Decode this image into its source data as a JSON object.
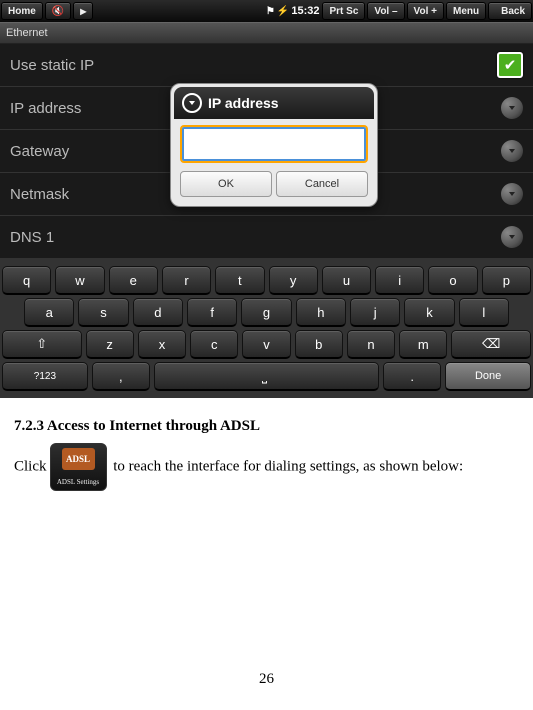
{
  "statusbar": {
    "home": "Home",
    "time": "15:32",
    "prtsc": "Prt Sc",
    "volDown": "Vol –",
    "volUp": "Vol +",
    "menu": "Menu",
    "back": "Back"
  },
  "titlebar": {
    "title": "Ethernet"
  },
  "rows": {
    "staticIp": "Use static IP",
    "ipAddress": "IP address",
    "gateway": "Gateway",
    "netmask": "Netmask",
    "dns1": "DNS 1"
  },
  "dialog": {
    "title": "IP address",
    "ok": "OK",
    "cancel": "Cancel"
  },
  "keys": {
    "row1": [
      "q",
      "w",
      "e",
      "r",
      "t",
      "y",
      "u",
      "i",
      "o",
      "p"
    ],
    "row2": [
      "a",
      "s",
      "d",
      "f",
      "g",
      "h",
      "j",
      "k",
      "l"
    ],
    "row3": [
      "z",
      "x",
      "c",
      "v",
      "b",
      "n",
      "m"
    ],
    "shift": "⇧",
    "bksp": "⌫",
    "sym": "?123",
    "comma": ",",
    "space": "␣",
    "period": ".",
    "done": "Done"
  },
  "doc": {
    "heading": "7.2.3 Access to Internet through ADSL",
    "clickPrefix": "Click",
    "clickSuffix": " to reach the interface for dialing settings, as shown below:",
    "adslLabel": "ADSL",
    "adslCaption": "ADSL Settings",
    "pageNumber": "26"
  }
}
